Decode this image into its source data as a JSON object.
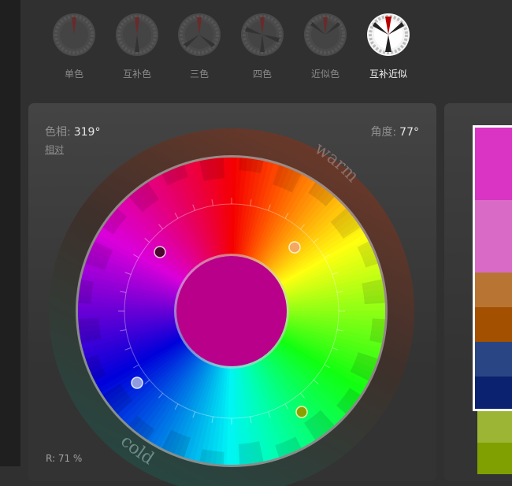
{
  "schemes": [
    {
      "label": "单色",
      "icon": "monochromatic-scheme-icon"
    },
    {
      "label": "互补色",
      "icon": "complementary-scheme-icon"
    },
    {
      "label": "三色",
      "icon": "triad-scheme-icon"
    },
    {
      "label": "四色",
      "icon": "tetrad-scheme-icon"
    },
    {
      "label": "近似色",
      "icon": "analogic-scheme-icon"
    },
    {
      "label": "互补近似",
      "icon": "accented-analogic-scheme-icon"
    }
  ],
  "active_scheme": 5,
  "hue": {
    "label": "色相:",
    "value": "319°"
  },
  "angle": {
    "label": "角度:",
    "value": "77°"
  },
  "relative_link": "相对",
  "wheel": {
    "warm_label": "warm",
    "cold_label": "cold",
    "center_color": "#b8008a"
  },
  "rgb_readout": "R: 71 %",
  "colors": {
    "accent_red": "#c00000",
    "swatches": [
      "#d934c4",
      "#d96bc6",
      "#b87433",
      "#a35000",
      "#2a4583",
      "#0a2270"
    ],
    "extra_swatches": [
      "#9db534",
      "#7fa000"
    ]
  }
}
